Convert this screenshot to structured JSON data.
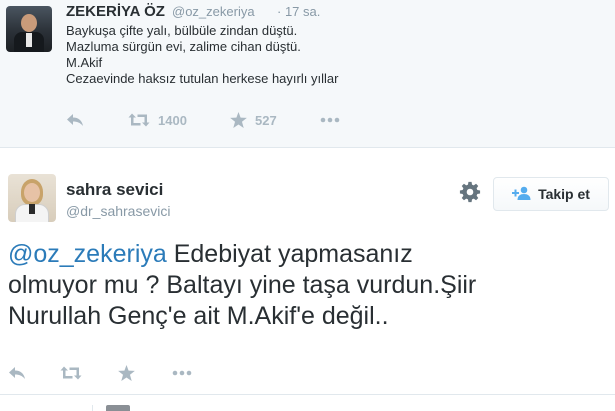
{
  "tweet1": {
    "author_name": "ZEKERİYA ÖZ",
    "author_handle": "@oz_zekeriya",
    "time": "· 17 sa.",
    "lines": [
      "Baykuşa çifte yalı, bülbüle zindan düştü.",
      "Mazluma sürgün evi, zalime cihan düştü.",
      "M.Akif",
      "Cezaevinde haksız tutulan herkese hayırlı yıllar"
    ],
    "retweet_count": "1400",
    "favorite_count": "527",
    "icons": [
      "reply-icon",
      "retweet-icon",
      "favorite-icon",
      "more-icon"
    ]
  },
  "tweet2": {
    "author_name": "sahra sevici",
    "author_handle": "@dr_sahrasevici",
    "follow_label": "Takip et",
    "mention": "@oz_zekeriya",
    "line1_rest": " Edebiyat yapmasanız",
    "line2": "olmuyor mu ? Baltayı yine taşa vurdun.Şiir",
    "line3": "Nurullah Genç'e ait M.Akif'e değil..",
    "icons": [
      "reply-icon",
      "retweet-icon",
      "favorite-icon",
      "more-icon",
      "gear-icon",
      "add-user-icon"
    ]
  },
  "colors": {
    "link": "#2b7bb9",
    "muted": "#8899a6",
    "icon": "#aab8c2",
    "text": "#292f33",
    "context_bg": "#f5f8fa"
  }
}
